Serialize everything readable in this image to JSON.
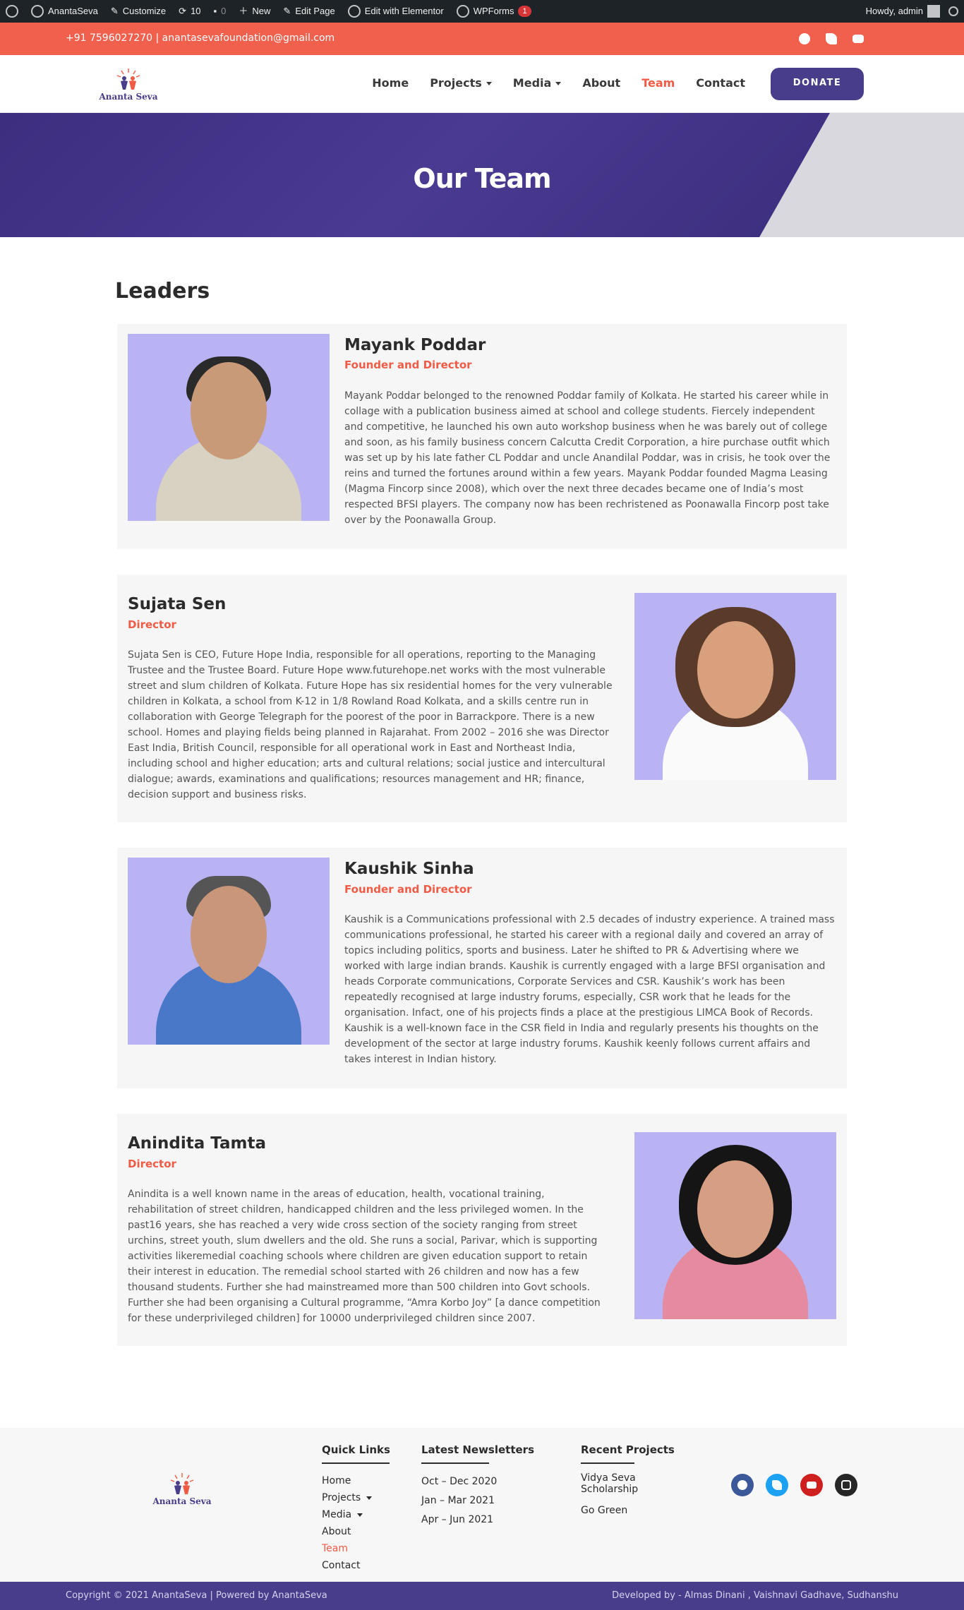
{
  "adminbar": {
    "site": "AnantaSeva",
    "customize": "Customize",
    "updates": "10",
    "comments": "0",
    "new": "New",
    "edit_page": "Edit Page",
    "elementor": "Edit with Elementor",
    "wpforms": "WPForms",
    "wpforms_badge": "1",
    "howdy": "Howdy, admin"
  },
  "topbar": {
    "contact": "+91 7596027270  |  anantasevafoundation@gmail.com",
    "social": [
      "facebook-icon",
      "twitter-icon",
      "youtube-icon"
    ]
  },
  "header": {
    "logo_text": "Ananta Seva",
    "nav": [
      {
        "label": "Home",
        "dropdown": false
      },
      {
        "label": "Projects",
        "dropdown": true
      },
      {
        "label": "Media",
        "dropdown": true
      },
      {
        "label": "About",
        "dropdown": false
      },
      {
        "label": "Team",
        "dropdown": false,
        "active": true
      },
      {
        "label": "Contact",
        "dropdown": false
      }
    ],
    "donate": "DONATE"
  },
  "hero": {
    "title": "Our Team"
  },
  "leaders": {
    "title": "Leaders",
    "people": [
      {
        "name": "Mayank Poddar",
        "role": "Founder and Director",
        "bio": "Mayank Poddar belonged to the renowned Poddar family of Kolkata. He started his career while in collage with a publication business aimed at school and college students. Fiercely independent and competitive, he launched his own auto workshop business when he was barely out of college and soon, as his family business concern Calcutta Credit Corporation, a hire purchase outfit which was set up by his late father CL Poddar and uncle Anandilal Poddar, was in crisis, he took over the reins and turned the fortunes around within a few years. Mayank Poddar founded Magma Leasing (Magma Fincorp since 2008), which over the next three decades became one of India’s most respected BFSI players. The company now has been rechristened as Poonawalla Fincorp post take over by the Poonawalla Group."
      },
      {
        "name": "Sujata Sen",
        "role": "Director",
        "bio": "Sujata Sen is CEO, Future Hope India, responsible for all operations, reporting to the Managing Trustee and the Trustee Board. Future Hope www.futurehope.net works with the most vulnerable street and slum children of Kolkata. Future Hope has six residential homes for the very vulnerable children in Kolkata, a school from K-12 in 1/8 Rowland Road Kolkata, and a skills centre run in collaboration with George Telegraph for the poorest of the poor in Barrackpore. There is a new school. Homes and playing fields being planned in Rajarahat. From 2002 – 2016 she was Director East India, British Council, responsible for all operational work in East and Northeast India, including school and higher education; arts and cultural relations; social justice and intercultural dialogue; awards, examinations and qualifications; resources management and HR; finance, decision support and business risks."
      },
      {
        "name": "Kaushik Sinha",
        "role": "Founder and Director",
        "bio": "Kaushik is a Communications professional with 2.5 decades of industry experience. A trained mass communications professional, he started his career with a regional daily and covered an array of topics including politics, sports and business. Later he shifted to PR & Advertising where we worked with large indian brands. Kaushik is currently engaged with a large BFSI organisation and heads Corporate communications, Corporate Services and CSR. Kaushik’s work has been repeatedly recognised at large industry forums, especially, CSR work that he leads for the organisation. Infact, one of his projects finds a place at the prestigious LIMCA Book of Records. Kaushik is a well-known face in the CSR field in India and regularly presents his thoughts on the development of the sector at large industry forums. Kaushik keenly follows current affairs and takes interest in Indian history."
      },
      {
        "name": "Anindita Tamta",
        "role": "Director",
        "bio": "Anindita is a well known name in the areas of education, health, vocational training, rehabilitation of street children, handicapped children and the less privileged women. In the past16 years, she has reached a very wide cross section of the society ranging from street urchins, street youth, slum dwellers and the old. She runs a social, Parivar, which is supporting activities likeremedial coaching schools where children are given education support to retain their interest in education. The remedial school started with 26 children and now has a few thousand students. Further she had mainstreamed more than 500 children into Govt schools. Further she had been organising a Cultural programme, “Amra Korbo Joy” [a dance competition for these underprivileged children] for 10000 underprivileged children since 2007."
      }
    ]
  },
  "footer": {
    "logo_text": "Ananta Seva",
    "quick_links": {
      "title": "Quick Links",
      "items": [
        {
          "label": "Home",
          "dropdown": false
        },
        {
          "label": "Projects",
          "dropdown": true
        },
        {
          "label": "Media",
          "dropdown": true
        },
        {
          "label": "About",
          "dropdown": false
        },
        {
          "label": "Team",
          "dropdown": false,
          "active": true
        },
        {
          "label": "Contact",
          "dropdown": false
        }
      ]
    },
    "newsletters": {
      "title": "Latest Newsletters",
      "items": [
        "Oct – Dec 2020",
        "Jan – Mar 2021",
        "Apr – Jun 2021"
      ]
    },
    "projects": {
      "title": "Recent Projects",
      "items": [
        "Vidya Seva Scholarship",
        "Go Green"
      ]
    },
    "social": [
      {
        "icon": "facebook-icon",
        "color": "#3b5998"
      },
      {
        "icon": "twitter-icon",
        "color": "#1da1f2"
      },
      {
        "icon": "youtube-icon",
        "color": "#cd201f"
      },
      {
        "icon": "instagram-icon",
        "color": "#262626"
      }
    ]
  },
  "copyright": {
    "left": "Copyright © 2021 AnantaSeva | Powered by AnantaSeva",
    "right": "Developed by - Almas Dinani , Vaishnavi Gadhave, Sudhanshu"
  },
  "colors": {
    "accent": "#ef5b45",
    "brand": "#473d8a",
    "topbar": "#f0604d"
  }
}
